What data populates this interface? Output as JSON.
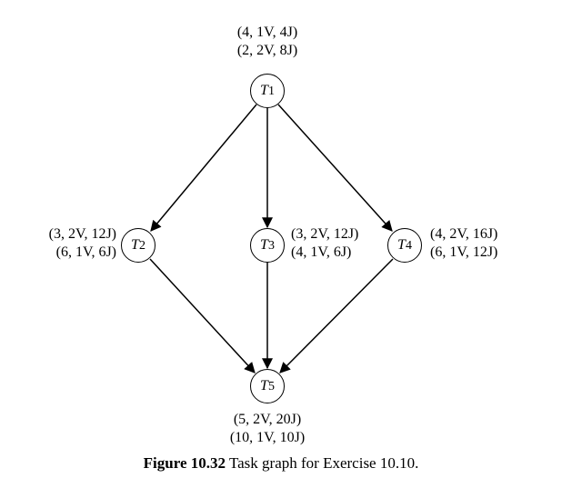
{
  "chart_data": {
    "type": "graph",
    "title": "Figure 10.32 Task graph for Exercise 10.10.",
    "nodes": [
      {
        "id": "T1",
        "modes": [
          {
            "t": 4,
            "v": "1V",
            "e": "4J"
          },
          {
            "t": 2,
            "v": "2V",
            "e": "8J"
          }
        ]
      },
      {
        "id": "T2",
        "modes": [
          {
            "t": 3,
            "v": "2V",
            "e": "12J"
          },
          {
            "t": 6,
            "v": "1V",
            "e": "6J"
          }
        ]
      },
      {
        "id": "T3",
        "modes": [
          {
            "t": 3,
            "v": "2V",
            "e": "12J"
          },
          {
            "t": 4,
            "v": "1V",
            "e": "6J"
          }
        ]
      },
      {
        "id": "T4",
        "modes": [
          {
            "t": 4,
            "v": "2V",
            "e": "16J"
          },
          {
            "t": 6,
            "v": "1V",
            "e": "12J"
          }
        ]
      },
      {
        "id": "T5",
        "modes": [
          {
            "t": 5,
            "v": "2V",
            "e": "20J"
          },
          {
            "t": 10,
            "v": "1V",
            "e": "10J"
          }
        ]
      }
    ],
    "edges": [
      [
        "T1",
        "T2"
      ],
      [
        "T1",
        "T3"
      ],
      [
        "T1",
        "T4"
      ],
      [
        "T2",
        "T5"
      ],
      [
        "T3",
        "T5"
      ],
      [
        "T4",
        "T5"
      ]
    ]
  },
  "labels": {
    "T1": {
      "letter": "T",
      "num": "1"
    },
    "T2": {
      "letter": "T",
      "num": "2"
    },
    "T3": {
      "letter": "T",
      "num": "3"
    },
    "T4": {
      "letter": "T",
      "num": "4"
    },
    "T5": {
      "letter": "T",
      "num": "5"
    }
  },
  "anno": {
    "T1a": "(4, 1V, 4J)",
    "T1b": "(2, 2V, 8J)",
    "T2a": "(3, 2V, 12J)",
    "T2b": "(6, 1V, 6J)",
    "T3a": "(3, 2V, 12J)",
    "T3b": "(4, 1V, 6J)",
    "T4a": "(4, 2V, 16J)",
    "T4b": "(6, 1V, 12J)",
    "T5a": "(5, 2V, 20J)",
    "T5b": "(10, 1V, 10J)"
  },
  "caption": {
    "bold": "Figure 10.32",
    "rest": " Task graph for Exercise 10.10."
  }
}
